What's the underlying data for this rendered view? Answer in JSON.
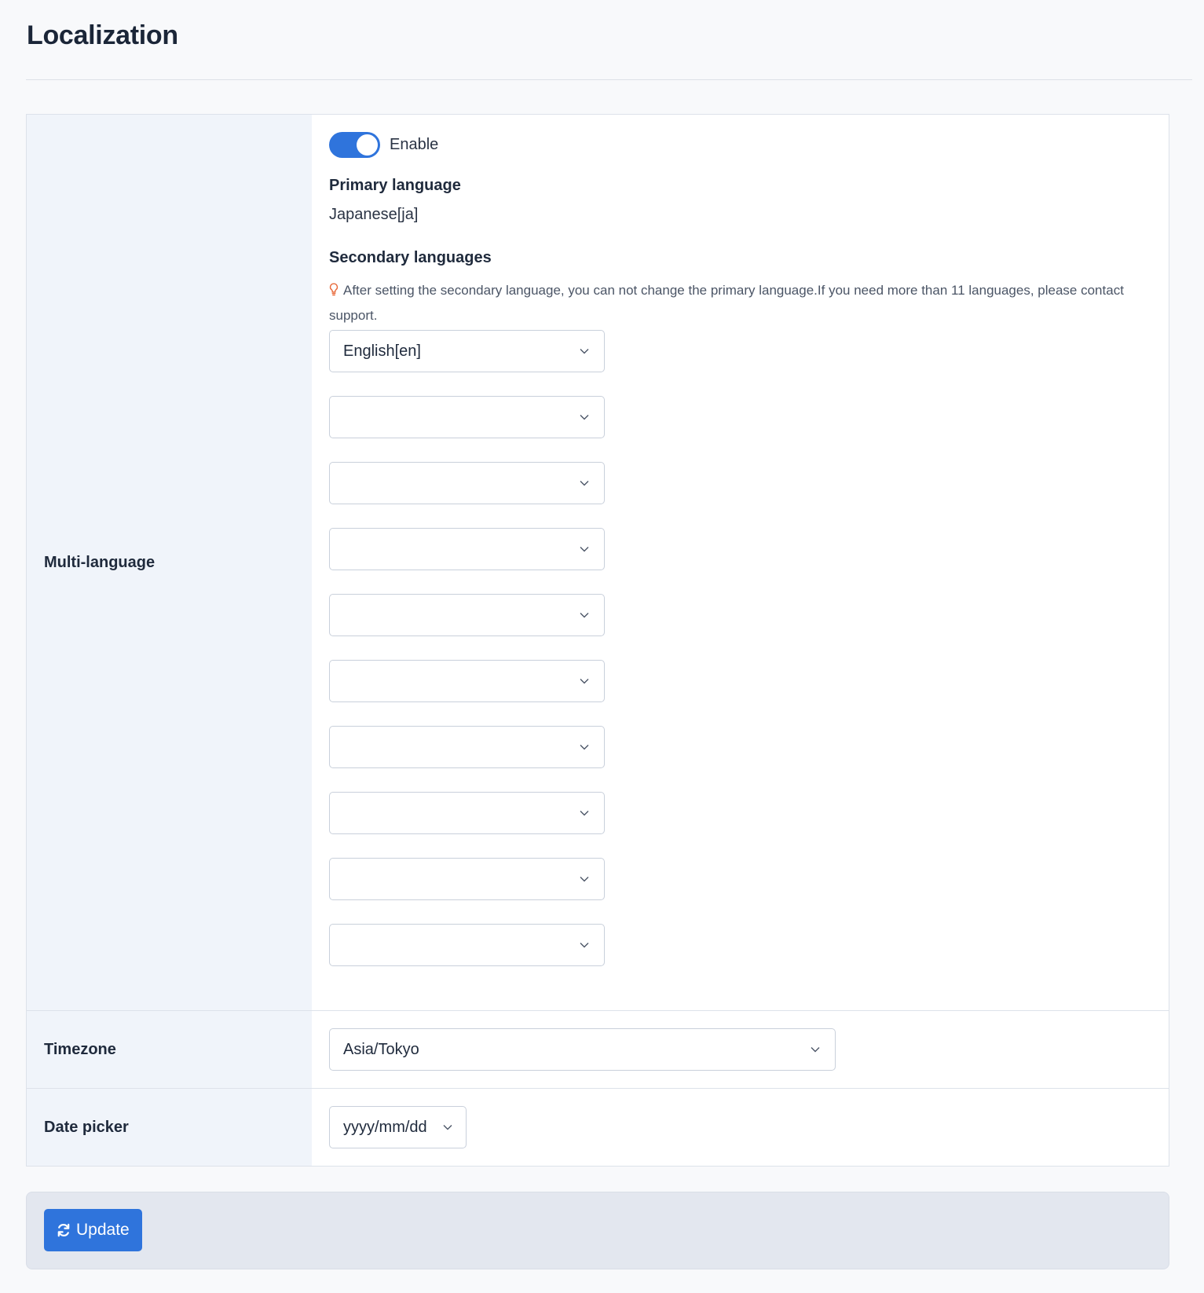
{
  "page": {
    "title": "Localization"
  },
  "multi_language": {
    "label": "Multi-language",
    "toggle_label": "Enable",
    "enabled": true,
    "primary_heading": "Primary language",
    "primary_value": "Japanese[ja]",
    "secondary_heading": "Secondary languages",
    "hint_icon": "lightbulb-icon",
    "hint_text": "After setting the secondary language, you can not change the primary language.If you need more than 11 languages, please contact support.",
    "selects": [
      {
        "value": "English[en]"
      },
      {
        "value": ""
      },
      {
        "value": ""
      },
      {
        "value": ""
      },
      {
        "value": ""
      },
      {
        "value": ""
      },
      {
        "value": ""
      },
      {
        "value": ""
      },
      {
        "value": ""
      },
      {
        "value": ""
      }
    ]
  },
  "timezone": {
    "label": "Timezone",
    "value": "Asia/Tokyo"
  },
  "date_picker": {
    "label": "Date picker",
    "value": "yyyy/mm/dd"
  },
  "footer": {
    "update_label": "Update",
    "update_icon": "refresh-icon"
  },
  "colors": {
    "accent": "#2f74dc",
    "hint_icon": "#e8693a",
    "label_bg": "#f0f4fa",
    "footer_bg": "#e3e7ef"
  }
}
